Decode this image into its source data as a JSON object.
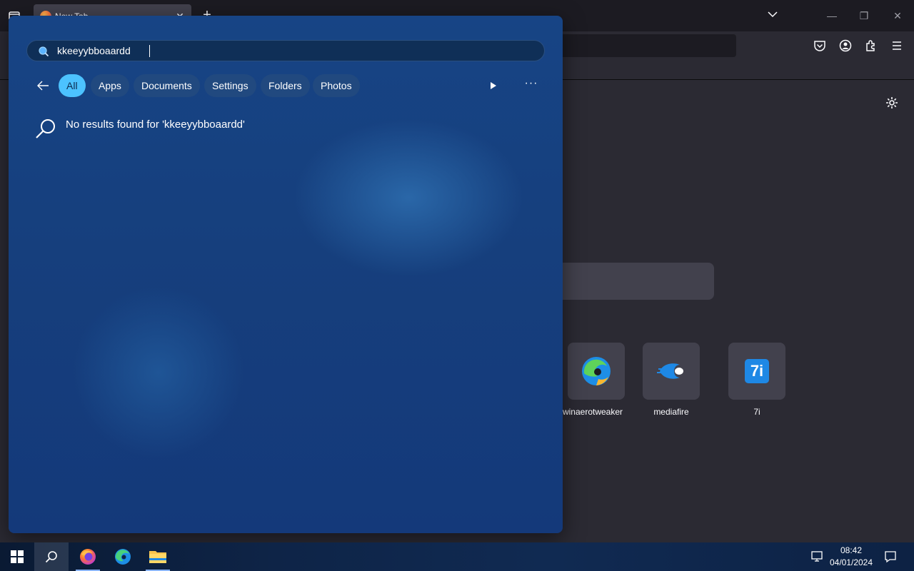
{
  "browser": {
    "tab_title": "New Tab",
    "shortcuts": [
      {
        "label": "winaerotweaker",
        "icon": "edge-style-swirl-icon"
      },
      {
        "label": "mediafire",
        "icon": "mediafire-icon"
      },
      {
        "label": "7i",
        "icon": "7i-icon"
      }
    ],
    "shortcut_7i_tile_text": "7i"
  },
  "search": {
    "query": "kkeeyybboaardd",
    "filters": [
      "All",
      "Apps",
      "Documents",
      "Settings",
      "Folders",
      "Photos"
    ],
    "active_filter": "All",
    "no_results_message": "No results found for 'kkeeyybboaardd'"
  },
  "taskbar": {
    "apps": [
      "start-icon",
      "search-icon",
      "firefox-icon",
      "edge-icon",
      "file-explorer-icon"
    ],
    "time": "08:42",
    "date": "04/01/2024"
  },
  "colors": {
    "accent": "#4cc2ff",
    "panel": "#164182",
    "browser_bg": "#2b2a33"
  }
}
